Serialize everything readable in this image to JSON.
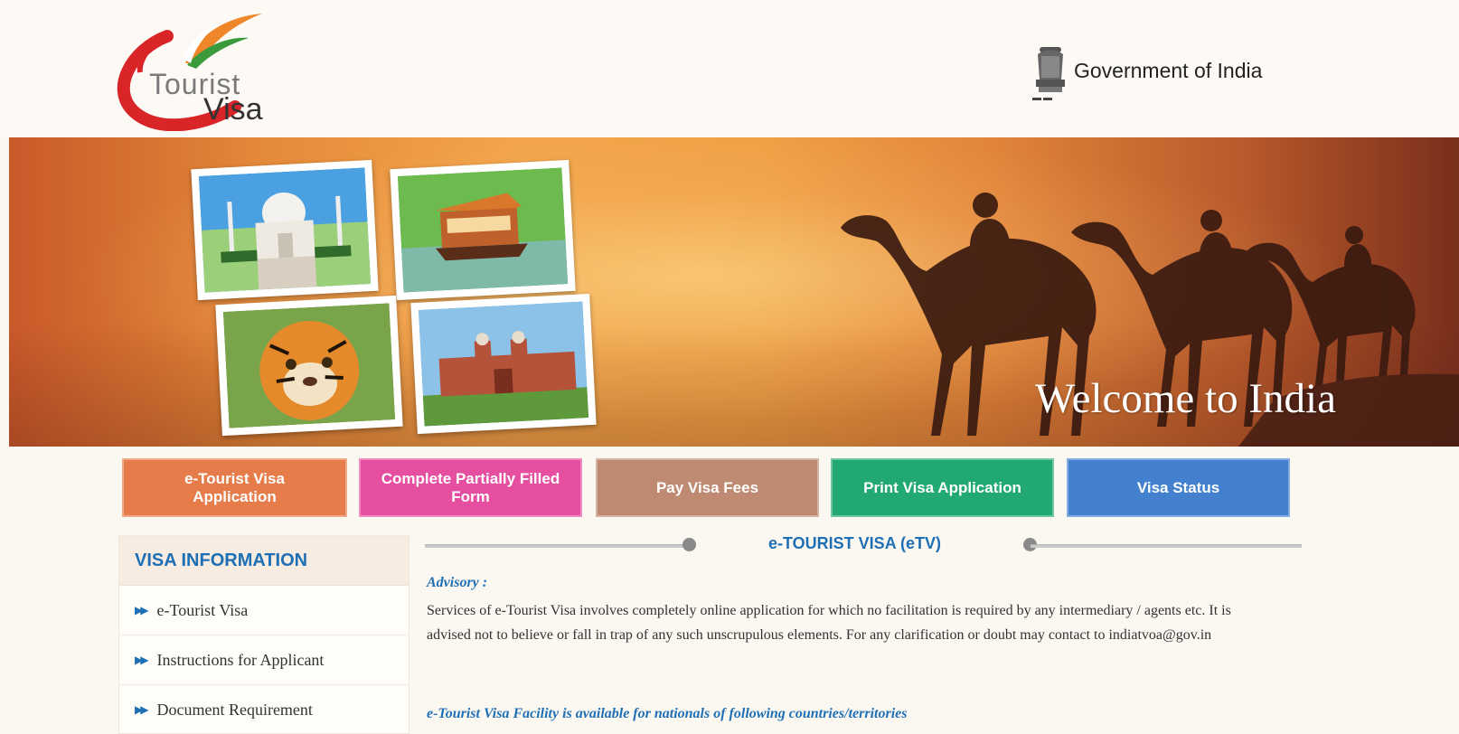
{
  "header": {
    "logo_top": "Tourist",
    "logo_bottom": "Visa",
    "government": "Government of India"
  },
  "banner": {
    "welcome": "Welcome to India"
  },
  "nav_buttons": [
    {
      "label": "e-Tourist Visa\nApplication",
      "color": "#e57c49"
    },
    {
      "label": "Complete Partially Filled\nForm",
      "color": "#e64e9f"
    },
    {
      "label": "Pay Visa Fees",
      "color": "#bf8a72"
    },
    {
      "label": "Print Visa Application",
      "color": "#22a872"
    },
    {
      "label": "Visa Status",
      "color": "#4380ce"
    }
  ],
  "sidebar": {
    "heading": "VISA INFORMATION",
    "items": [
      {
        "label": "e-Tourist Visa"
      },
      {
        "label": "Instructions for Applicant"
      },
      {
        "label": "Document Requirement"
      }
    ]
  },
  "main": {
    "section_title": "e-TOURIST VISA (eTV)",
    "advisory_label": "Advisory :",
    "advisory_text": "Services of e-Tourist Visa involves completely online application for which no facilitation is required by any intermediary / agents etc. It is advised not to believe or fall in trap of any such unscrupulous elements. For any clarification or doubt may contact to indiatvoa@gov.in",
    "facility_heading": "e-Tourist Visa Facility is available for nationals of following countries/territories"
  },
  "colors": {
    "accent_blue": "#1f6fb5",
    "banner_orange": "#efa044"
  }
}
